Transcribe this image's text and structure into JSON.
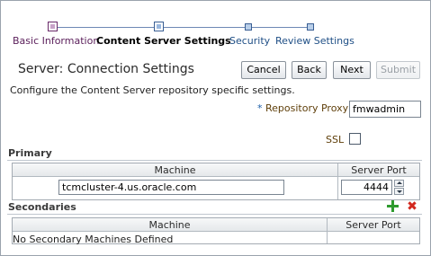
{
  "train": {
    "stops": [
      {
        "label": "Basic Information",
        "state": "visited"
      },
      {
        "label": "Content Server Settings",
        "state": "current"
      },
      {
        "label": "Security",
        "state": "next"
      },
      {
        "label": "Review Settings",
        "state": "next"
      }
    ]
  },
  "page": {
    "title": "Server: Connection Settings",
    "description": "Configure the Content Server repository specific settings."
  },
  "buttons": {
    "cancel": "Cancel",
    "back": "Back",
    "next": "Next",
    "submit": "Submit"
  },
  "form": {
    "required_marker": "*",
    "repository_proxy_label": "Repository Proxy",
    "repository_proxy_value": "fmwadmin",
    "ssl_label": "SSL",
    "ssl_checked": false
  },
  "primary": {
    "title": "Primary",
    "columns": [
      "Machine",
      "Server Port"
    ],
    "machine_value": "tcmcluster-4.us.oracle.com",
    "port_value": "4444"
  },
  "secondaries": {
    "title": "Secondaries",
    "columns": [
      "Machine",
      "Server Port"
    ],
    "empty_message": "No Secondary Machines Defined"
  },
  "icons": {
    "add": "add-icon",
    "delete": "delete-icon",
    "add_color": "#2e9a2e",
    "delete_color": "#d2281e"
  }
}
